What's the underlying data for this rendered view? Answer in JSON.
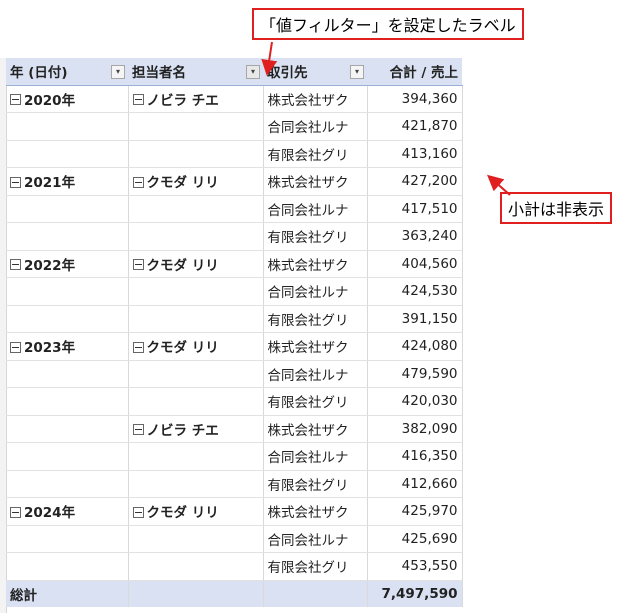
{
  "annotations": {
    "filter_label_callout": "「値フィルター」を設定したラベル",
    "subtotal_callout": "小計は非表示"
  },
  "pivot": {
    "headers": {
      "year": "年 (日付)",
      "person": "担当者名",
      "client": "取引先",
      "value": "合計 / 売上"
    },
    "rows": [
      {
        "year": "2020年",
        "person": "ノビラ チエ",
        "client": "株式会社ザク",
        "value": "394,360"
      },
      {
        "year": "",
        "person": "",
        "client": "合同会社ルナ",
        "value": "421,870"
      },
      {
        "year": "",
        "person": "",
        "client": "有限会社グリ",
        "value": "413,160"
      },
      {
        "year": "2021年",
        "person": "クモダ リリ",
        "client": "株式会社ザク",
        "value": "427,200"
      },
      {
        "year": "",
        "person": "",
        "client": "合同会社ルナ",
        "value": "417,510"
      },
      {
        "year": "",
        "person": "",
        "client": "有限会社グリ",
        "value": "363,240"
      },
      {
        "year": "2022年",
        "person": "クモダ リリ",
        "client": "株式会社ザク",
        "value": "404,560"
      },
      {
        "year": "",
        "person": "",
        "client": "合同会社ルナ",
        "value": "424,530"
      },
      {
        "year": "",
        "person": "",
        "client": "有限会社グリ",
        "value": "391,150"
      },
      {
        "year": "2023年",
        "person": "クモダ リリ",
        "client": "株式会社ザク",
        "value": "424,080"
      },
      {
        "year": "",
        "person": "",
        "client": "合同会社ルナ",
        "value": "479,590"
      },
      {
        "year": "",
        "person": "",
        "client": "有限会社グリ",
        "value": "420,030"
      },
      {
        "year": "",
        "person": "ノビラ チエ",
        "client": "株式会社ザク",
        "value": "382,090"
      },
      {
        "year": "",
        "person": "",
        "client": "合同会社ルナ",
        "value": "416,350"
      },
      {
        "year": "",
        "person": "",
        "client": "有限会社グリ",
        "value": "412,660"
      },
      {
        "year": "2024年",
        "person": "クモダ リリ",
        "client": "株式会社ザク",
        "value": "425,970"
      },
      {
        "year": "",
        "person": "",
        "client": "合同会社ルナ",
        "value": "425,690"
      },
      {
        "year": "",
        "person": "",
        "client": "有限会社グリ",
        "value": "453,550"
      }
    ],
    "total": {
      "label": "総計",
      "value": "7,497,590"
    }
  }
}
